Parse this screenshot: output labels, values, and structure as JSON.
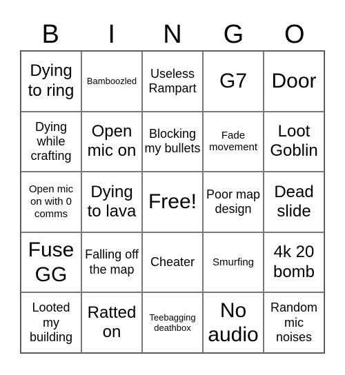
{
  "header": {
    "letters": [
      "B",
      "I",
      "N",
      "G",
      "O"
    ]
  },
  "grid": {
    "rows": [
      [
        "Dying to ring",
        "Bamboozled",
        "Useless Rampart",
        "G7",
        "Door"
      ],
      [
        "Dying while crafting",
        "Open mic on",
        "Blocking my bullets",
        "Fade movement",
        "Loot Goblin"
      ],
      [
        "Open mic on with 0 comms",
        "Dying to lava",
        "Free!",
        "Poor map design",
        "Dead slide"
      ],
      [
        "Fuse GG",
        "Falling off the map",
        "Cheater",
        "Smurfing",
        "4k 20 bomb"
      ],
      [
        "Looted my building",
        "Ratted on",
        "Teebagging deathbox",
        "No audio",
        "Random mic noises"
      ]
    ]
  }
}
